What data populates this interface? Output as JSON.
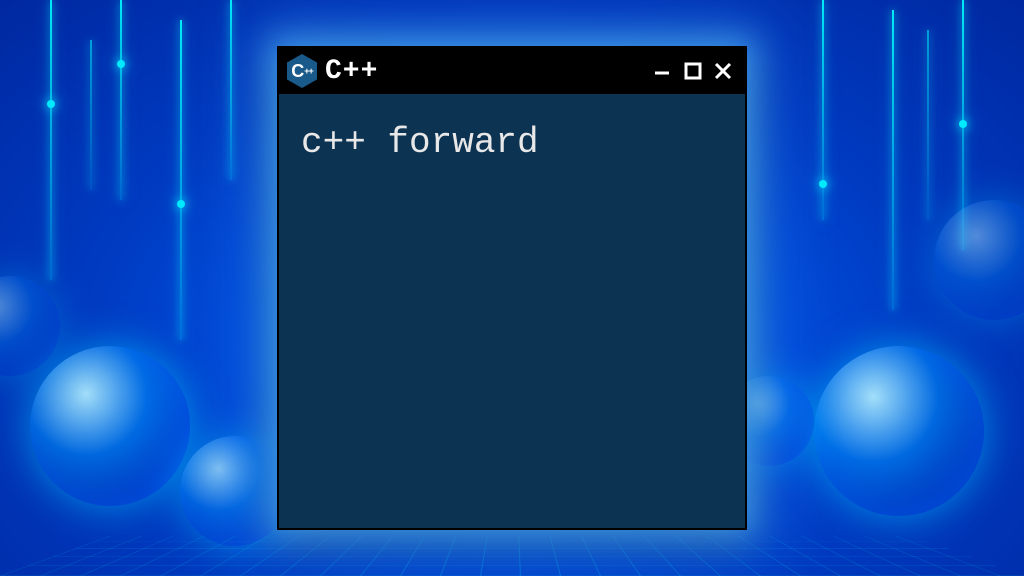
{
  "window": {
    "title": "C++",
    "icon_letter": "C",
    "icon_plus": "++"
  },
  "content": {
    "line1": "c++ forward"
  }
}
